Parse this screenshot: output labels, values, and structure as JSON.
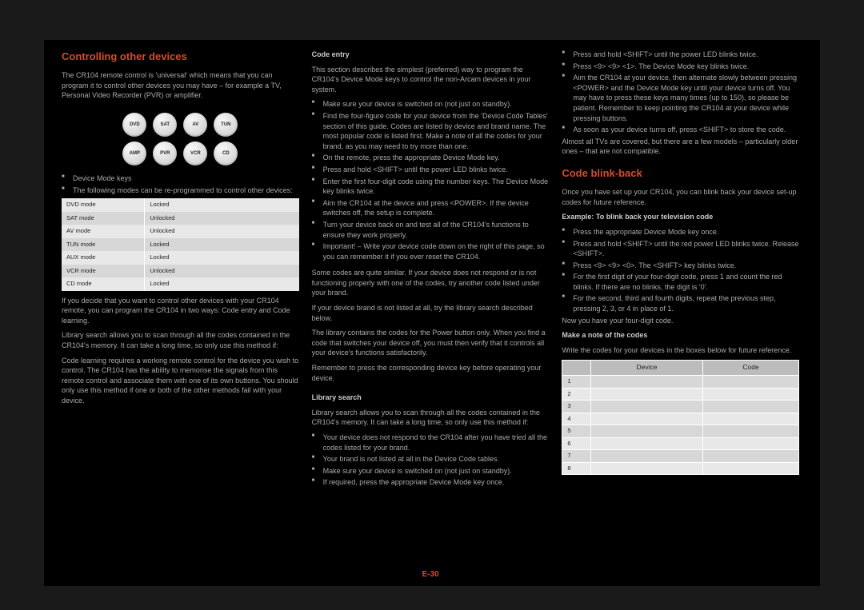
{
  "pageNumber": "E-30",
  "col1": {
    "heading": "Controlling other devices",
    "p1": "The CR104 remote control is 'universal' which means that you can program it to control other devices you may have – for example a TV, Personal Video Recorder (PVR) or amplifier.",
    "buttons": [
      "DVD",
      "SAT",
      "AV",
      "TUN",
      "AMP",
      "PVR",
      "VCR",
      "CD"
    ],
    "bullets1": [
      "Device Mode keys",
      "The following modes can be re-programmed to control other devices:"
    ],
    "modeTable": [
      [
        "DVD mode",
        "Locked"
      ],
      [
        "SAT mode",
        "Unlocked"
      ],
      [
        "AV mode",
        "Unlocked"
      ],
      [
        "TUN mode",
        "Locked"
      ],
      [
        "AUX mode",
        "Locked"
      ],
      [
        "VCR mode",
        "Unlocked"
      ],
      [
        "CD mode",
        "Locked"
      ]
    ],
    "p2": "If you decide that you want to control other devices with your CR104 remote, you can program the CR104 in two ways: Code entry and Code learning.",
    "p3": "Library search allows you to scan through all the codes contained in the CR104's memory. It can take a long time, so only use this method if:",
    "p4": "Code learning requires a working remote control for the device you wish to control. The CR104 has the ability to memorise the signals from this remote control and associate them with one of its own buttons. You should only use this method if one or both of the other methods fail with your device."
  },
  "col2": {
    "h1": "Code entry",
    "p1": "This section describes the simplest (preferred) way to program the CR104's Device Mode keys to control the non-Arcam devices in your system.",
    "ul1": [
      "Make sure your device is switched on (not just on standby).",
      "Find the four-figure code for your device from the 'Device Code Tables' section of this guide. Codes are listed by device and brand name. The most popular code is listed first. Make a note of all the codes for your brand, as you may need to try more than one.",
      "On the remote, press the appropriate Device Mode key.",
      "Press and hold <SHIFT> until the power LED blinks twice.",
      "Enter the first four-digit code using the number keys. The Device Mode key blinks twice.",
      "Aim the CR104 at the device and press <POWER>. If the device switches off, the setup is complete.",
      "Turn your device back on and test all of the CR104's functions to ensure they work properly.",
      "Important! – Write your device code down on the right of this page, so you can remember it if you ever reset the CR104."
    ],
    "note": "Some codes are quite similar. If your device does not respond or is not functioning properly with one of the codes, try another code listed under your brand.",
    "note2": "If your device brand is not listed at all, try the library search described below.",
    "note3": "The library contains the codes for the Power button only. When you find a code that switches your device off, you must then verify that it controls all your device's functions satisfactorily.",
    "note4": "Remember to press the corresponding device key before operating your device.",
    "h2": "Library search",
    "p2": "Library search allows you to scan through all the codes contained in the CR104's memory. It can take a long time, so only use this method if:",
    "ul2": [
      "Your device does not respond to the CR104 after you have tried all the codes listed for your brand.",
      "Your brand is not listed at all in the Device Code tables.",
      "Make sure your device is switched on (not just on standby).",
      "If required, press the appropriate Device Mode key once."
    ]
  },
  "col3": {
    "ul1": [
      "Press and hold <SHIFT> until the power LED blinks twice.",
      "Press <9> <9> <1>. The Device Mode key blinks twice.",
      "Aim the CR104 at your device, then alternate slowly between pressing <POWER> and the Device Mode key until your device turns off. You may have to press these keys many times (up to 150), so please be patient. Remember to keep pointing the CR104 at your device while pressing buttons.",
      "As soon as your device turns off, press <SHIFT> to store the code."
    ],
    "p1": "Almost all TVs are covered, but there are a few models – particularly older ones – that are not compatible.",
    "heading": "Code blink-back",
    "p2": "Once you have set up your CR104, you can blink back your device set-up codes for future reference.",
    "ex1": "Example: To blink back your television code",
    "ul2": [
      "Press the appropriate Device Mode key once.",
      "Press and hold <SHIFT> until the red power LED blinks twice. Release <SHIFT>.",
      "Press <9> <9> <0>. The <SHIFT> key blinks twice.",
      "For the first digit of your four-digit code, press 1 and count the red blinks. If there are no blinks, the digit is '0'.",
      "For the second, third and fourth digits, repeat the previous step, pressing 2, 3, or 4 in place of 1."
    ],
    "p3": "Now you have your four-digit code.",
    "p4": "Make a note of the codes",
    "p5": "Write the codes for your devices in the boxes below for future reference.",
    "codeTable": {
      "headers": [
        "",
        "Device",
        "Code"
      ],
      "rows": [
        "1",
        "2",
        "3",
        "4",
        "5",
        "6",
        "7",
        "8"
      ]
    }
  }
}
